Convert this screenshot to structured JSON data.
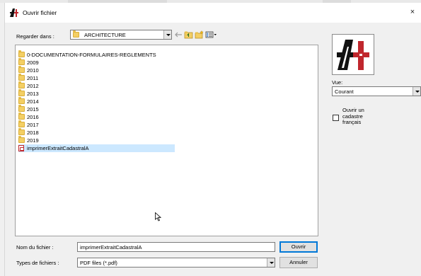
{
  "window": {
    "title": "Ouvrir fichier",
    "close_glyph": "×"
  },
  "toolbar": {
    "look_in_label": "Regarder dans :",
    "look_in_value": "ARCHITECTURE",
    "icons": [
      "back-arrow-icon",
      "up-folder-icon",
      "new-folder-icon",
      "view-menu-icon"
    ]
  },
  "files": [
    {
      "name": "0-DOCUMENTATION-FORMULAIRES-REGLEMENTS",
      "type": "folder"
    },
    {
      "name": "2009",
      "type": "folder"
    },
    {
      "name": "2010",
      "type": "folder"
    },
    {
      "name": "2011",
      "type": "folder"
    },
    {
      "name": "2012",
      "type": "folder"
    },
    {
      "name": "2013",
      "type": "folder"
    },
    {
      "name": "2014",
      "type": "folder"
    },
    {
      "name": "2015",
      "type": "folder"
    },
    {
      "name": "2016",
      "type": "folder"
    },
    {
      "name": "2017",
      "type": "folder"
    },
    {
      "name": "2018",
      "type": "folder"
    },
    {
      "name": "2019",
      "type": "folder"
    },
    {
      "name": "imprimerExtraitCadastralA",
      "type": "pdf",
      "selected": true
    }
  ],
  "filename": {
    "label": "Nom du fichier :",
    "value": "imprimerExtraitCadastralA"
  },
  "filetype": {
    "label": "Types de fichiers :",
    "value": "PDF files (*.pdf)"
  },
  "buttons": {
    "open": "Ouvrir",
    "cancel": "Annuler"
  },
  "right_panel": {
    "vue_label": "Vue:",
    "vue_value": "Courant",
    "checkbox_lines": [
      "Ouvrir un",
      "cadastre",
      "français"
    ],
    "checkbox_checked": false
  },
  "colors": {
    "selection": "#cce8ff",
    "default_button_border": "#0078d7",
    "folder": "#f4cf64",
    "pdf": "#c0272d"
  }
}
